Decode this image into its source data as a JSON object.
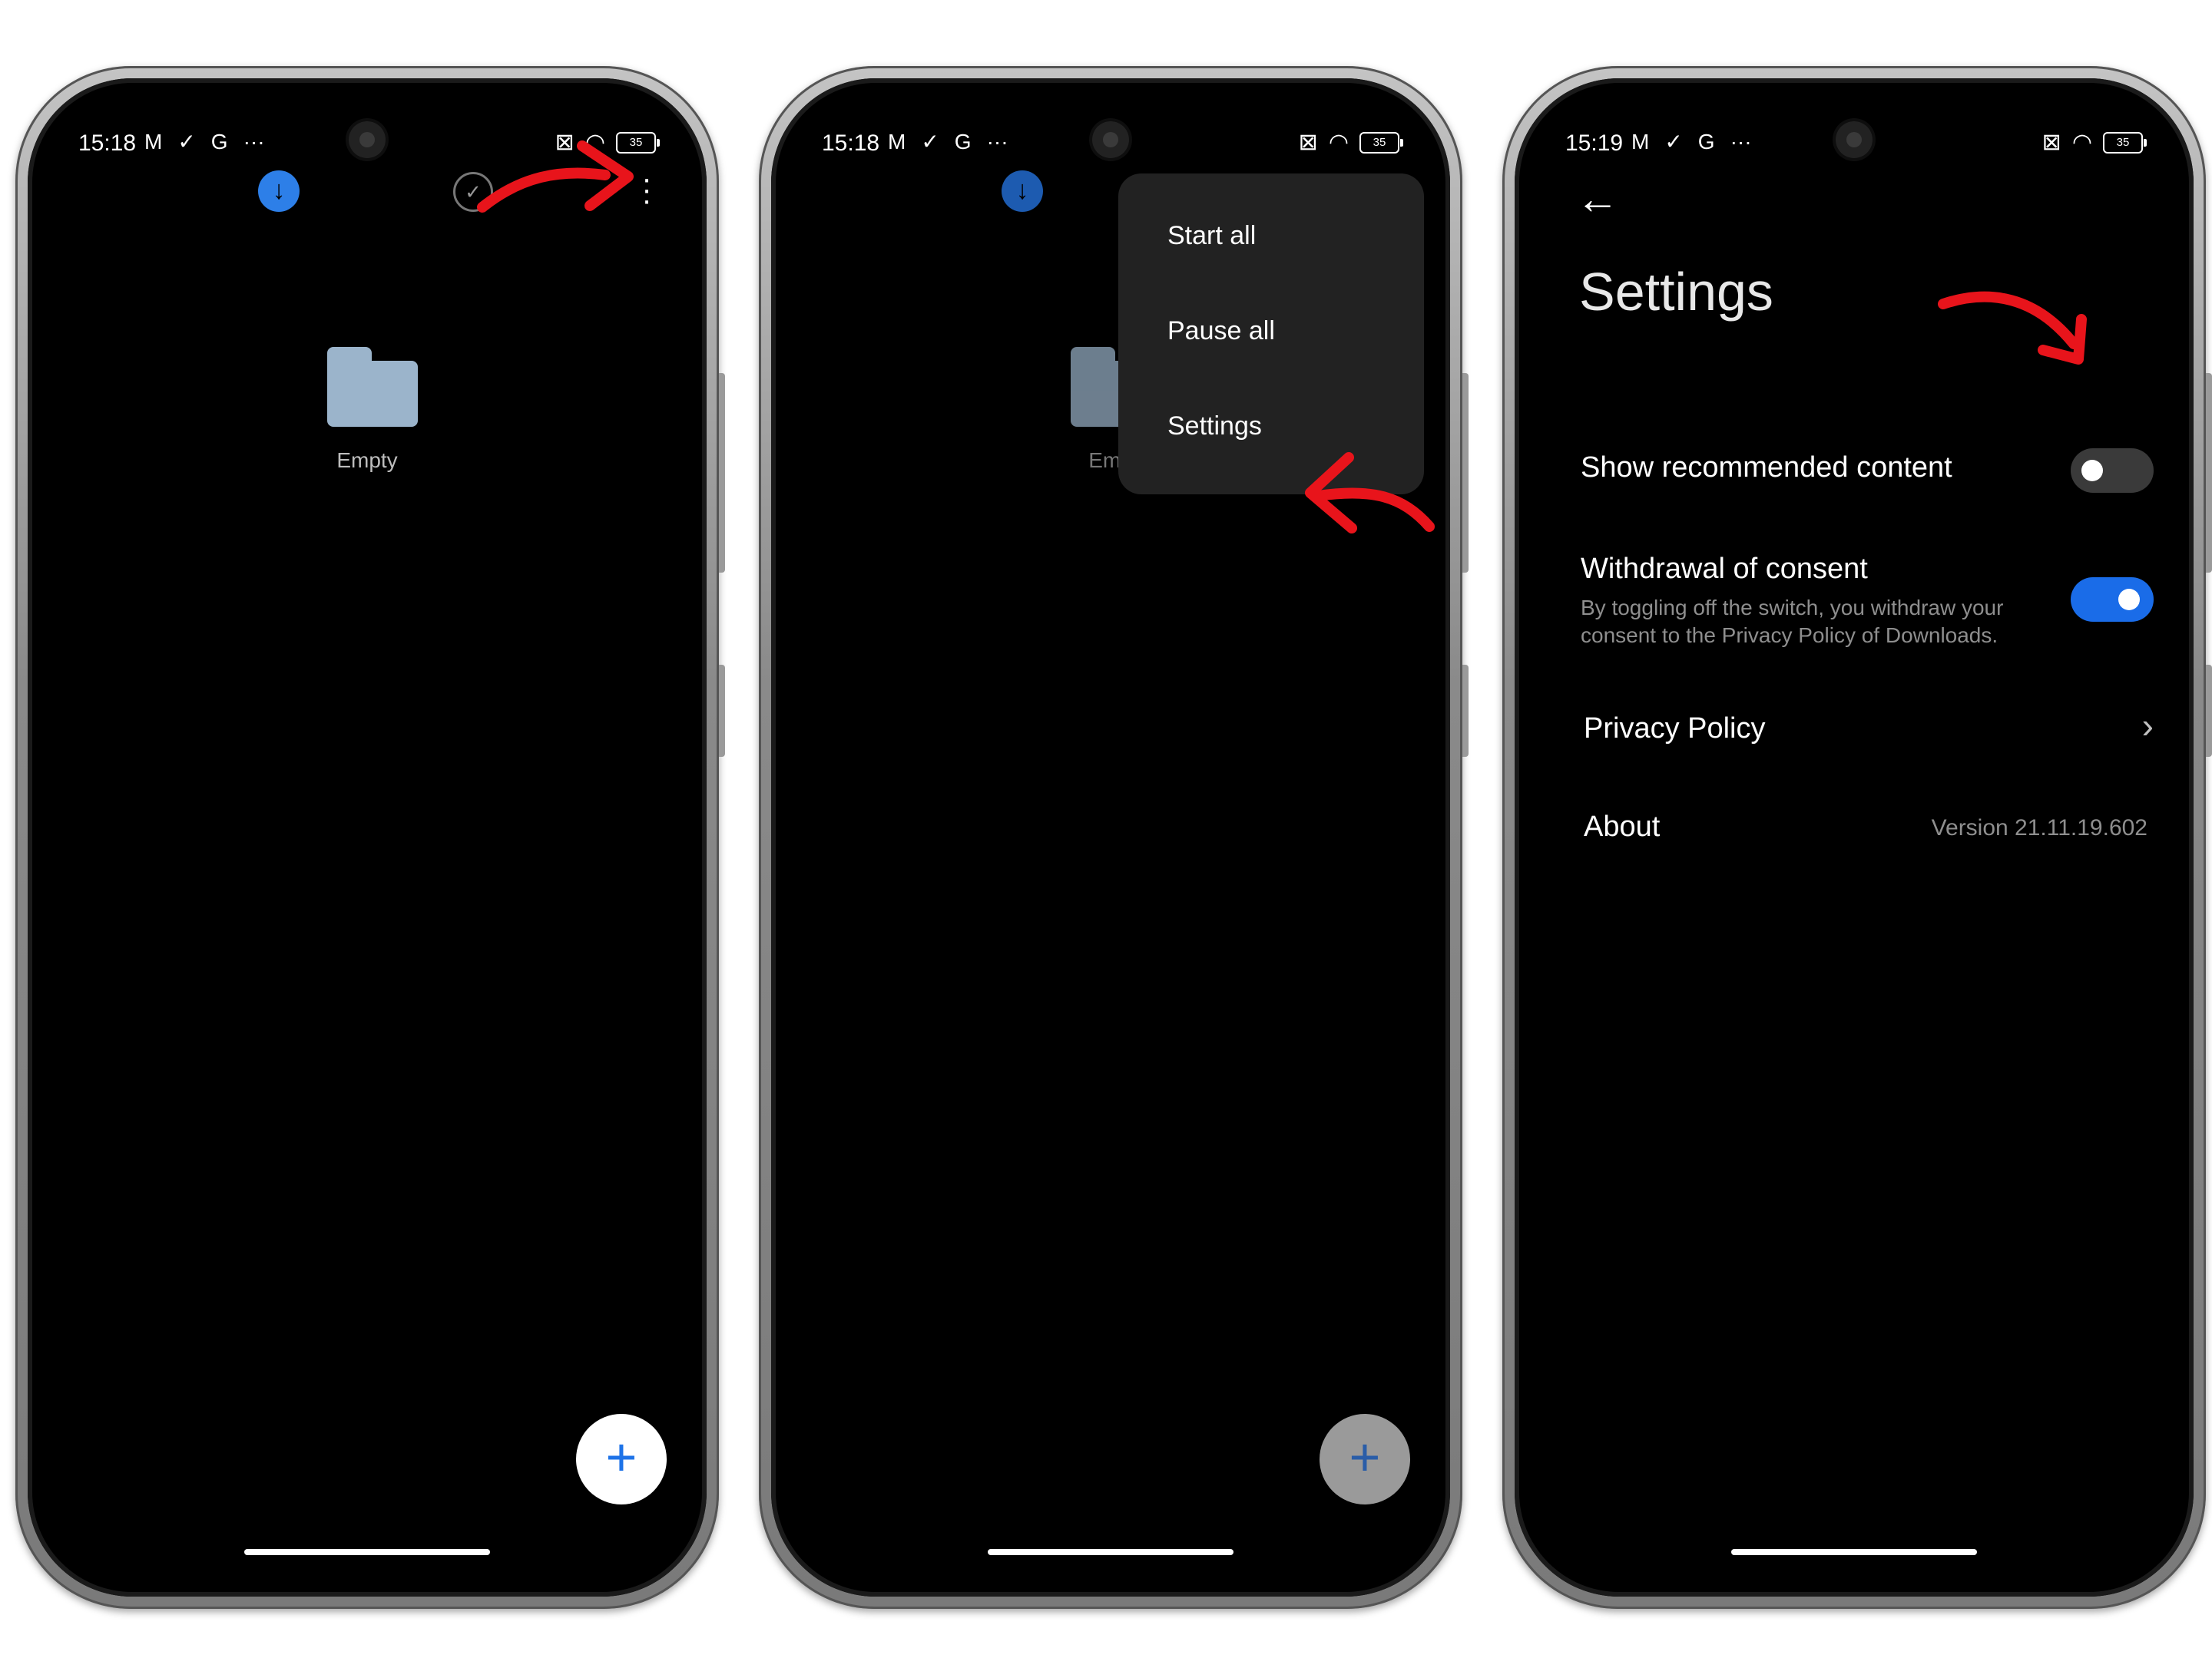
{
  "status": {
    "screen1_time": "15:18",
    "screen2_time": "15:18",
    "screen3_time": "15:19",
    "notification_icons": [
      "gmail-icon",
      "check-icon",
      "google-icon",
      "more-icon"
    ],
    "battery": "35"
  },
  "screen1": {
    "folder_label": "Empty",
    "fab_icon": "+"
  },
  "screen2": {
    "folder_label_partial": "Emp",
    "menu": [
      "Start all",
      "Pause all",
      "Settings"
    ],
    "fab_icon": "+"
  },
  "screen3": {
    "title": "Settings",
    "show_recommended": {
      "label": "Show recommended content",
      "on": false
    },
    "withdrawal": {
      "label": "Withdrawal of consent",
      "description": "By toggling off the switch, you withdraw your consent to the Privacy Policy of Downloads.",
      "on": true
    },
    "privacy_policy": "Privacy Policy",
    "about": {
      "label": "About",
      "version": "Version 21.11.19.602"
    }
  },
  "colors": {
    "accent": "#1a6ce8",
    "annotation_arrow": "#e8141b",
    "folder": "#9bb4cb"
  }
}
